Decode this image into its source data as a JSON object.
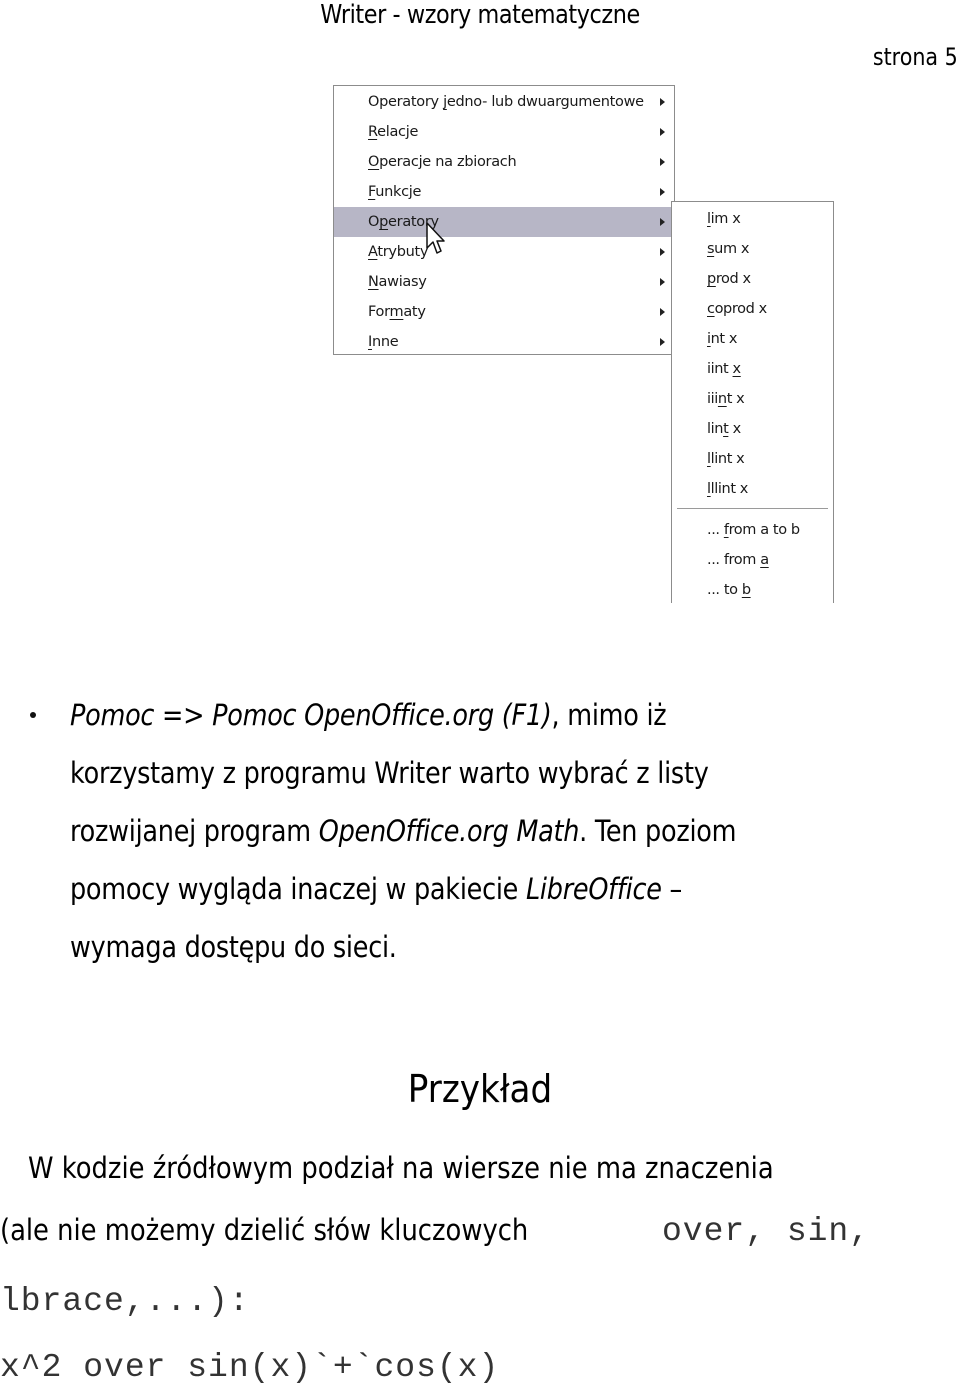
{
  "header": {
    "title": "Writer - wzory matematyczne",
    "page_number": "strona 5"
  },
  "menu": {
    "items": [
      {
        "label_pre": "Operatory ",
        "label_u": "j",
        "label_post": "edno- lub dwuargumentowe",
        "selected": false
      },
      {
        "label_pre": "",
        "label_u": "R",
        "label_post": "elacje",
        "selected": false
      },
      {
        "label_pre": "",
        "label_u": "O",
        "label_post": "peracje na zbiorach",
        "selected": false
      },
      {
        "label_pre": "",
        "label_u": "F",
        "label_post": "unkcje",
        "selected": false
      },
      {
        "label_pre": "O",
        "label_u": "p",
        "label_post": "eratory",
        "selected": true
      },
      {
        "label_pre": "",
        "label_u": "A",
        "label_post": "trybuty",
        "selected": false
      },
      {
        "label_pre": "",
        "label_u": "N",
        "label_post": "awiasy",
        "selected": false
      },
      {
        "label_pre": "For",
        "label_u": "m",
        "label_post": "aty",
        "selected": false
      },
      {
        "label_pre": "",
        "label_u": "I",
        "label_post": "nne",
        "selected": false
      }
    ],
    "submenu_parent": "Operatory",
    "submenu_items": [
      {
        "label_pre": "",
        "label_u": "l",
        "label_post": "im x"
      },
      {
        "label_pre": "",
        "label_u": "s",
        "label_post": "um x"
      },
      {
        "label_pre": "",
        "label_u": "p",
        "label_post": "rod x"
      },
      {
        "label_pre": "",
        "label_u": "c",
        "label_post": "oprod x"
      },
      {
        "label_pre": "",
        "label_u": "i",
        "label_post": "nt x"
      },
      {
        "label_pre": "iint ",
        "label_u": "x",
        "label_post": ""
      },
      {
        "label_pre": "iii",
        "label_u": "n",
        "label_post": "t x"
      },
      {
        "label_pre": "lin",
        "label_u": "t",
        "label_post": " x"
      },
      {
        "label_pre": "",
        "label_u": "l",
        "label_post": "lint x"
      },
      {
        "label_pre": "",
        "label_u": "l",
        "label_post": "llint x"
      }
    ],
    "submenu_limits": [
      {
        "label_pre": "... ",
        "label_u": "f",
        "label_post": "rom a to b"
      },
      {
        "label_pre": "... from ",
        "label_u": "a",
        "label_post": ""
      },
      {
        "label_pre": "... to ",
        "label_u": "b",
        "label_post": ""
      }
    ]
  },
  "body": {
    "bullet": {
      "line1_italic": "Pomoc => Pomoc OpenOffice.org (F1)",
      "line1_rest": ", mimo iż",
      "line2": "korzystamy z programu Writer warto wybrać z listy",
      "line3_pre": "rozwijanej program ",
      "line3_italic": "OpenOffice.org Math",
      "line3_post": ". Ten poziom",
      "line4_pre": "pomocy wygląda inaczej w pakiecie ",
      "line4_italic": "LibreOffice",
      "line4_post": " –",
      "line5": "wymaga dostępu do sieci."
    },
    "section_title": "Przykład",
    "para1": "W kodzie źródłowym podział na wiersze nie ma znaczenia",
    "para2_text": "(ale nie możemy dzielić słów kluczowych ",
    "para2_code": "over, sin,",
    "para3_code": "lbrace,...):",
    "code_example": "x^2 over sin(x)`+`cos(x)"
  }
}
